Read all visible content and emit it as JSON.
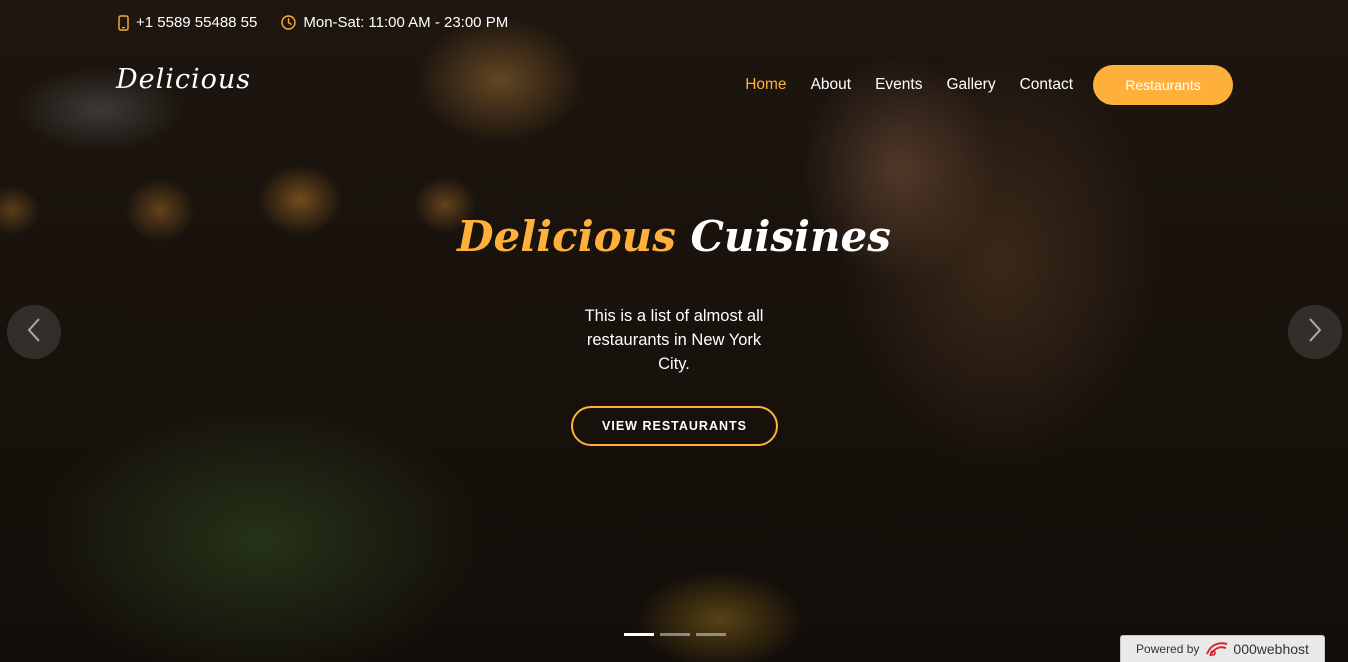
{
  "topbar": {
    "phone": "+1 5589 55488 55",
    "hours": "Mon-Sat: 11:00 AM - 23:00 PM",
    "phone_icon": "phone-icon",
    "hours_icon": "clock-icon"
  },
  "header": {
    "logo": "Delicious",
    "nav": [
      "Home",
      "About",
      "Events",
      "Gallery",
      "Contact"
    ],
    "active": "Home",
    "cta_label": "Restaurants"
  },
  "hero": {
    "title_accent": "Delicious",
    "title_rest": "Cuisines",
    "description": "This is a list of almost all restaurants in New York City.",
    "button_label": "VIEW RESTAURANTS"
  },
  "carousel": {
    "slide_count": 3,
    "active_index": 0,
    "prev_icon": "chevron-left-icon",
    "next_icon": "chevron-right-icon"
  },
  "badge": {
    "label": "Powered by",
    "brand": "000webhost"
  },
  "colors": {
    "accent": "#ffb03b",
    "text": "#ffffff"
  }
}
